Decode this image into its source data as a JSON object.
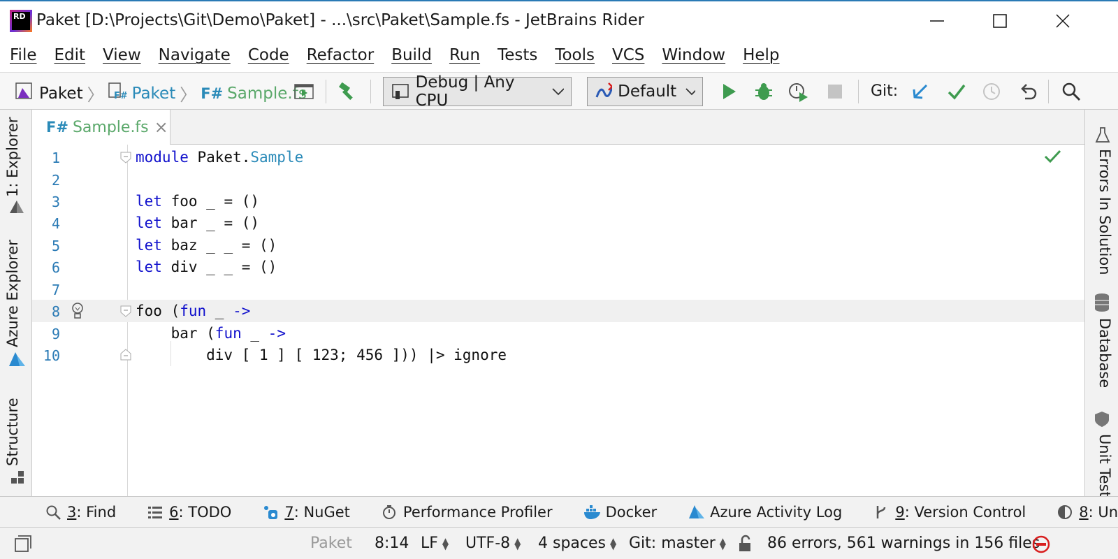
{
  "window": {
    "title": "Paket [D:\\Projects\\Git\\Demo\\Paket] - ...\\src\\Paket\\Sample.fs - JetBrains Rider",
    "app_icon_text": "RD"
  },
  "menu": [
    "File",
    "Edit",
    "View",
    "Navigate",
    "Code",
    "Refactor",
    "Build",
    "Run",
    "Tests",
    "Tools",
    "VCS",
    "Window",
    "Help"
  ],
  "breadcrumbs": {
    "solution": "Paket",
    "project": "Paket",
    "file_lang": "F#",
    "file": "Sample.fs"
  },
  "toolbar": {
    "config": "Debug | Any CPU",
    "run_target": "Default",
    "git_label": "Git:"
  },
  "left_tabs": [
    "1: Explorer",
    "Azure Explorer",
    "Structure"
  ],
  "right_tabs": [
    "Errors In Solution",
    "Database",
    "Unit Tests"
  ],
  "editor_tab": {
    "lang": "F#",
    "name": "Sample.fs",
    "close": "×"
  },
  "code_lines": [
    {
      "n": "1",
      "text": "module Paket.Sample"
    },
    {
      "n": "2",
      "text": ""
    },
    {
      "n": "3",
      "text": "let foo _ = ()"
    },
    {
      "n": "4",
      "text": "let bar _ = ()"
    },
    {
      "n": "5",
      "text": "let baz _ _ = ()"
    },
    {
      "n": "6",
      "text": "let div _ _ = ()"
    },
    {
      "n": "7",
      "text": ""
    },
    {
      "n": "8",
      "text": "foo (fun _ ->"
    },
    {
      "n": "9",
      "text": "    bar (fun _ ->"
    },
    {
      "n": "10",
      "text": "        div [ 1 ] [ 123; 456 ])) |> ignore"
    }
  ],
  "bottom_tools": [
    {
      "num": "3",
      "label": ": Find"
    },
    {
      "num": "6",
      "label": ": TODO"
    },
    {
      "num": "7",
      "label": ": NuGet"
    },
    {
      "num": "",
      "label": "Performance Profiler"
    },
    {
      "num": "",
      "label": "Docker"
    },
    {
      "num": "",
      "label": "Azure Activity Log"
    },
    {
      "num": "9",
      "label": ": Version Control"
    },
    {
      "num": "8",
      "label": ": Unit Tests"
    }
  ],
  "status": {
    "project": "Paket",
    "position": "8:14",
    "line_sep": "LF",
    "encoding": "UTF-8",
    "indent": "4 spaces",
    "git_branch": "Git: master",
    "problems": "86 errors, 561 warnings in 156 files"
  },
  "colors": {
    "keyword": "#1010cc",
    "namespace": "#2a8ab8",
    "line_number": "#2a7ab5",
    "run_green": "#3e9b4f",
    "error_red": "#d81e1e"
  }
}
